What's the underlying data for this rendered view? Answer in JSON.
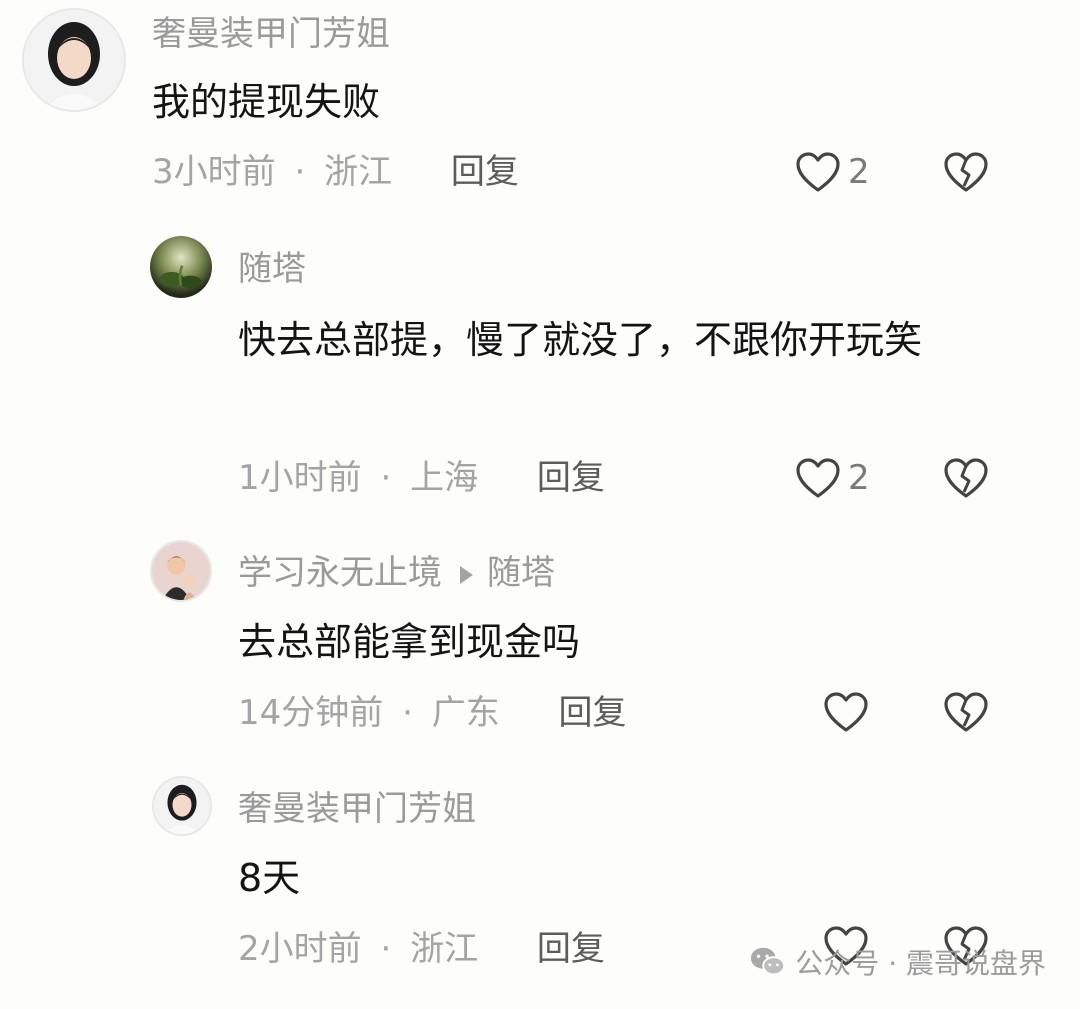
{
  "comments": [
    {
      "name": "奢曼装甲门芳姐",
      "text": "我的提现失败",
      "time": "3小时前",
      "location": "浙江",
      "reply": "回复",
      "likes": "2"
    },
    {
      "name": "随塔",
      "text": "快去总部提，慢了就没了，不跟你开玩笑",
      "time": "1小时前",
      "location": "上海",
      "reply": "回复",
      "likes": "2"
    },
    {
      "name": "学习永无止境",
      "reply_to": "随塔",
      "text": "去总部能拿到现金吗",
      "time": "14分钟前",
      "location": "广东",
      "reply": "回复",
      "likes": ""
    },
    {
      "name": "奢曼装甲门芳姐",
      "text": "8天",
      "time": "2小时前",
      "location": "浙江",
      "reply": "回复",
      "likes": ""
    }
  ],
  "separator": "·",
  "icons": {
    "like": "heart-outline-icon",
    "dislike": "broken-heart-icon",
    "wechat": "wechat-icon"
  },
  "watermark": "公众号 · 震哥说盘界"
}
